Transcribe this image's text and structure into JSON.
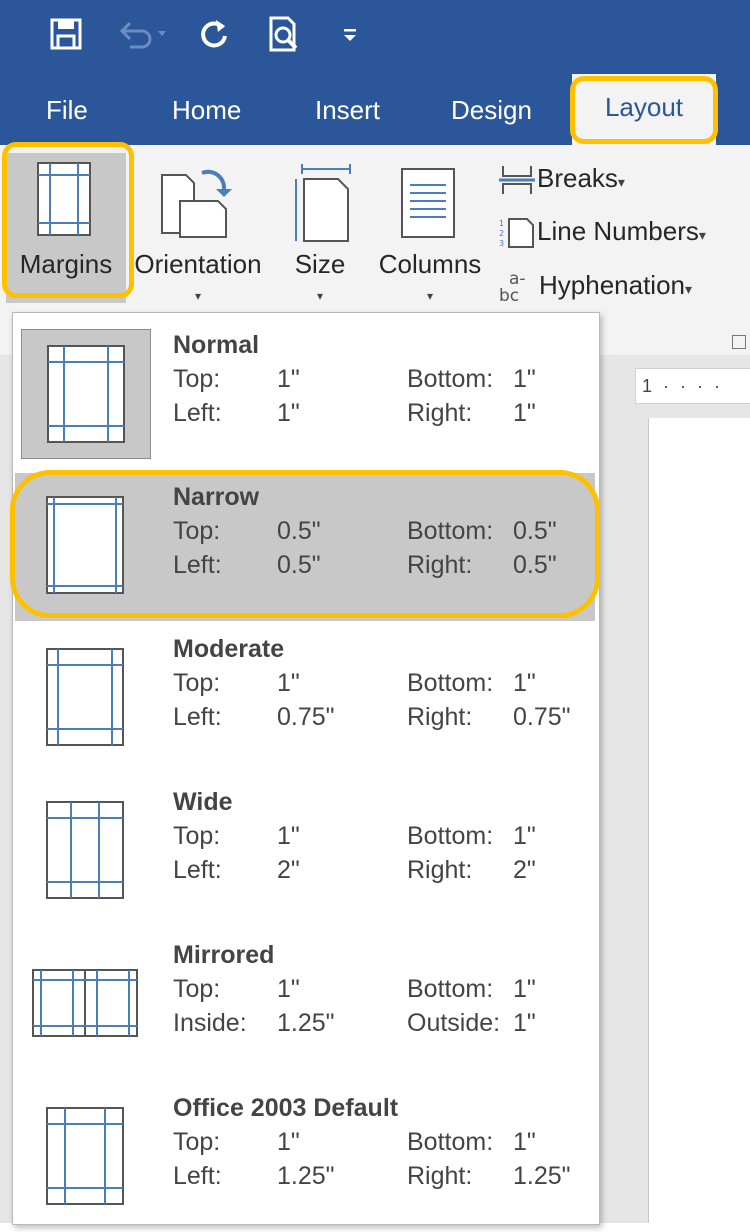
{
  "quick_access": [
    {
      "name": "save-icon"
    },
    {
      "name": "undo-icon"
    },
    {
      "name": "redo-icon"
    },
    {
      "name": "print-preview-icon"
    },
    {
      "name": "customize-qat-icon"
    }
  ],
  "tabs": [
    "File",
    "Home",
    "Insert",
    "Design",
    "Layout"
  ],
  "ribbon": {
    "margins": "Margins",
    "orientation": "Orientation",
    "size": "Size",
    "columns": "Columns",
    "breaks": "Breaks",
    "line_numbers": "Line Numbers",
    "hyphenation": "Hyphenation",
    "caret": "▾"
  },
  "ruler": "1 · · · ·",
  "presets": [
    {
      "title": "Normal",
      "k1": "Top:",
      "v1": "1\"",
      "k2": "Bottom:",
      "v2": "1\"",
      "k3": "Left:",
      "v3": "1\"",
      "k4": "Right:",
      "v4": "1\""
    },
    {
      "title": "Narrow",
      "k1": "Top:",
      "v1": "0.5\"",
      "k2": "Bottom:",
      "v2": "0.5\"",
      "k3": "Left:",
      "v3": "0.5\"",
      "k4": "Right:",
      "v4": "0.5\""
    },
    {
      "title": "Moderate",
      "k1": "Top:",
      "v1": "1\"",
      "k2": "Bottom:",
      "v2": "1\"",
      "k3": "Left:",
      "v3": "0.75\"",
      "k4": "Right:",
      "v4": "0.75\""
    },
    {
      "title": "Wide",
      "k1": "Top:",
      "v1": "1\"",
      "k2": "Bottom:",
      "v2": "1\"",
      "k3": "Left:",
      "v3": "2\"",
      "k4": "Right:",
      "v4": "2\""
    },
    {
      "title": "Mirrored",
      "k1": "Top:",
      "v1": "1\"",
      "k2": "Bottom:",
      "v2": "1\"",
      "k3": "Inside:",
      "v3": "1.25\"",
      "k4": "Outside:",
      "v4": "1\""
    },
    {
      "title": "Office 2003 Default",
      "k1": "Top:",
      "v1": "1\"",
      "k2": "Bottom:",
      "v2": "1\"",
      "k3": "Left:",
      "v3": "1.25\"",
      "k4": "Right:",
      "v4": "1.25\""
    }
  ],
  "colors": {
    "brand": "#2b579a",
    "highlight": "#ffc000",
    "margin_line": "#4a7ebb"
  }
}
